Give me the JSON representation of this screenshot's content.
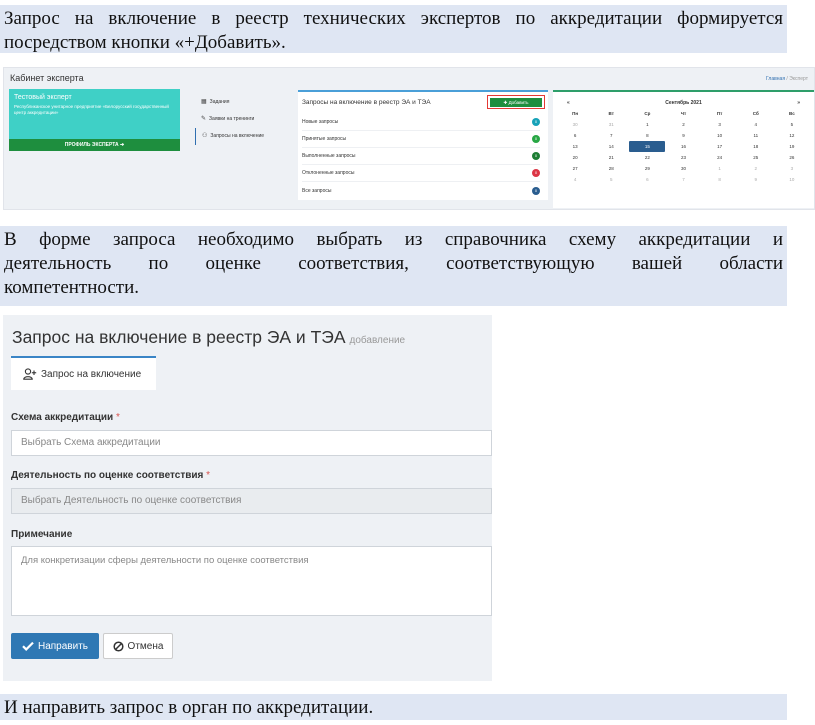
{
  "doc": {
    "para1_line1": "Запрос на включение в реестр технических экспертов по аккредитации формируется",
    "para1_line2": "посредством кнопки «+Добавить».",
    "para2_line1": "В форме запроса необходимо выбрать из справочника схему аккредитации и",
    "para2_line2": "деятельность по оценке соответствия, соответствующую вашей области",
    "para2_line3": "компетентности.",
    "para3": "И направить запрос в орган по аккредитации."
  },
  "cabinet": {
    "title": "Кабинет эксперта",
    "breadcrumb_home": "Главная",
    "breadcrumb_sep": "/",
    "breadcrumb_current": "Эксперт",
    "profile": {
      "name": "Тестовый эксперт",
      "org": "Республиканское унитарное предприятие «Белорусский государственный центр аккредитации»",
      "button": "ПРОФИЛЬ ЭКСПЕРТА ➔"
    },
    "menu": [
      {
        "label": "Задания",
        "icon": "calendar-icon"
      },
      {
        "label": "Заявки на тренинги",
        "icon": "wrench-icon"
      },
      {
        "label": "Запросы на включение",
        "icon": "user-plus-icon"
      }
    ],
    "requests": {
      "title": "Запросы на включение в реестр ЭА и ТЭА",
      "add_button": "Добавить",
      "rows": [
        {
          "label": "Новые запросы",
          "count": "0",
          "color": "#17a2b8"
        },
        {
          "label": "Принятые запросы",
          "count": "0",
          "color": "#28a745"
        },
        {
          "label": "Выполненные запросы",
          "count": "0",
          "color": "#1e7e34"
        },
        {
          "label": "Отклоненные запросы",
          "count": "0",
          "color": "#dc3545"
        },
        {
          "label": "Все запросы",
          "count": "0",
          "color": "#2a5d8f"
        }
      ]
    },
    "calendar": {
      "prev": "«",
      "month": "Сентябрь 2021",
      "next": "»",
      "days": [
        "Пн",
        "Вт",
        "Ср",
        "Чт",
        "Пт",
        "Сб",
        "Вс"
      ],
      "weeks": [
        [
          "30",
          "31",
          "1",
          "2",
          "3",
          "4",
          "5"
        ],
        [
          "6",
          "7",
          "8",
          "9",
          "10",
          "11",
          "12"
        ],
        [
          "13",
          "14",
          "15",
          "16",
          "17",
          "18",
          "19"
        ],
        [
          "20",
          "21",
          "22",
          "23",
          "24",
          "25",
          "26"
        ],
        [
          "27",
          "28",
          "29",
          "30",
          "1",
          "2",
          "3"
        ],
        [
          "4",
          "5",
          "6",
          "7",
          "8",
          "9",
          "10"
        ]
      ],
      "today": "15"
    }
  },
  "form": {
    "title": "Запрос на включение в реестр ЭА и ТЭА",
    "subtitle": "добавление",
    "tab": "Запрос на включение",
    "scheme_label": "Схема аккредитации",
    "scheme_placeholder": "Выбрать Схема аккредитации",
    "activity_label": "Деятельность по оценке соответствия",
    "activity_placeholder": "Выбрать Деятельность по оценке соответствия",
    "required_mark": "*",
    "note_label": "Примечание",
    "note_placeholder": "Для конкретизации сферы деятельности по оценке соответствия",
    "submit": "Направить",
    "cancel": "Отмена"
  }
}
